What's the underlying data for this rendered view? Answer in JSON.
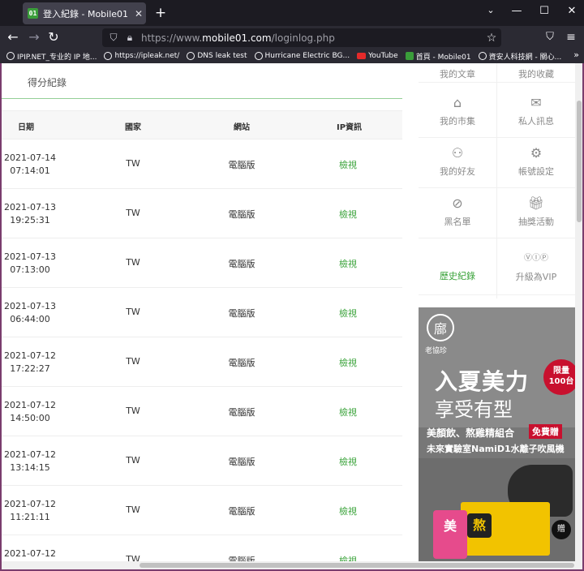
{
  "browser": {
    "tab_title": "登入紀錄 - Mobile01",
    "favicon_text": "01",
    "url_prefix": "https://www.",
    "url_domain": "mobile01.com",
    "url_path": "/loginlog.php",
    "bookmarks": [
      {
        "label": "IPIP.NET_专业的 IP 地...",
        "icon": "globe-icon"
      },
      {
        "label": "https://ipleak.net/",
        "icon": "globe-icon"
      },
      {
        "label": "DNS leak test",
        "icon": "globe-icon"
      },
      {
        "label": "Hurricane Electric BG...",
        "icon": "globe-icon"
      },
      {
        "label": "YouTube",
        "icon": "youtube-icon"
      },
      {
        "label": "首頁 - Mobile01",
        "icon": "mobile01-icon"
      },
      {
        "label": "資安人科技網 - 關心...",
        "icon": "globe-icon"
      }
    ]
  },
  "page": {
    "section_title": "得分紀錄",
    "table": {
      "headers": {
        "date": "日期",
        "country": "國家",
        "site": "網站",
        "ip": "IP資訊"
      },
      "rows": [
        {
          "date": "2021-07-14",
          "time": "07:14:01",
          "country": "TW",
          "site": "電腦版",
          "ip": "檢視"
        },
        {
          "date": "2021-07-13",
          "time": "19:25:31",
          "country": "TW",
          "site": "電腦版",
          "ip": "檢視"
        },
        {
          "date": "2021-07-13",
          "time": "07:13:00",
          "country": "TW",
          "site": "電腦版",
          "ip": "檢視"
        },
        {
          "date": "2021-07-13",
          "time": "06:44:00",
          "country": "TW",
          "site": "電腦版",
          "ip": "檢視"
        },
        {
          "date": "2021-07-12",
          "time": "17:22:27",
          "country": "TW",
          "site": "電腦版",
          "ip": "檢視"
        },
        {
          "date": "2021-07-12",
          "time": "14:50:00",
          "country": "TW",
          "site": "電腦版",
          "ip": "檢視"
        },
        {
          "date": "2021-07-12",
          "time": "13:14:15",
          "country": "TW",
          "site": "電腦版",
          "ip": "檢視"
        },
        {
          "date": "2021-07-12",
          "time": "11:21:11",
          "country": "TW",
          "site": "電腦版",
          "ip": "檢視"
        },
        {
          "date": "2021-07-12",
          "time": "",
          "country": "TW",
          "site": "電腦版",
          "ip": "檢視"
        }
      ]
    }
  },
  "sidebar": {
    "items": [
      {
        "label": "我的文章",
        "icon": "article-icon",
        "active": false
      },
      {
        "label": "我的收藏",
        "icon": "bookmark-icon",
        "active": false
      },
      {
        "label": "我的市集",
        "icon": "store-icon",
        "active": false
      },
      {
        "label": "私人訊息",
        "icon": "mail-icon",
        "active": false
      },
      {
        "label": "我的好友",
        "icon": "friends-icon",
        "active": false
      },
      {
        "label": "帳號設定",
        "icon": "gear-icon",
        "active": false
      },
      {
        "label": "黑名單",
        "icon": "block-icon",
        "active": false
      },
      {
        "label": "抽獎活動",
        "icon": "gift-icon",
        "active": false
      },
      {
        "label": "歷史紀錄",
        "icon": "",
        "active": true
      },
      {
        "label": "升級為VIP",
        "icon": "vip-icon",
        "active": false
      }
    ]
  },
  "ad": {
    "logo_char": "廍",
    "brand": "老協珍",
    "headline1": "入夏美力",
    "headline2": "享受有型",
    "badge_line1": "限量",
    "badge_line2": "100台",
    "promo": "美顏飲、熬雞精組合",
    "free": "免費贈",
    "line2": "未來實驗室NamiD1水離子吹風機",
    "product1_text": "美",
    "product2_text": "熬",
    "gift_text": "贈"
  }
}
